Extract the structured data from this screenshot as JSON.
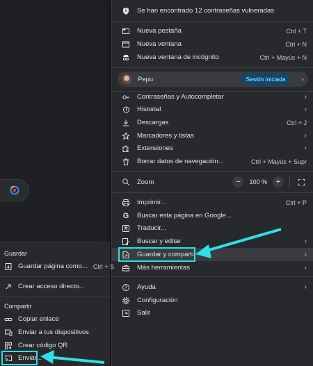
{
  "colors": {
    "bg": "#1f2023",
    "menu": "#28292c",
    "accent": "#2ee0e8",
    "badge": "#0b4a6f"
  },
  "banner": {
    "icon": "shield-icon",
    "text": "Se han encontrado 12 contraseñas vulneradas"
  },
  "group1": [
    {
      "icon": "tab-icon",
      "label": "Nueva pestaña",
      "shortcut": "Ctrl + T"
    },
    {
      "icon": "window-icon",
      "label": "Nueva ventana",
      "shortcut": "Ctrl + N"
    },
    {
      "icon": "incognito-icon",
      "label": "Nueva ventana de incógnito",
      "shortcut": "Ctrl + Mayús + N"
    }
  ],
  "profile": {
    "name": "Pepu",
    "status": "Sesión iniciada"
  },
  "group2": [
    {
      "icon": "key-icon",
      "label": "Contraseñas y Autocompletar",
      "shortcut": ""
    },
    {
      "icon": "history-icon",
      "label": "Historial",
      "shortcut": ""
    },
    {
      "icon": "download-icon",
      "label": "Descargas",
      "shortcut": "Ctrl + J"
    },
    {
      "icon": "star-icon",
      "label": "Marcadores y listas",
      "shortcut": ""
    },
    {
      "icon": "puzzle-icon",
      "label": "Extensiones",
      "shortcut": ""
    },
    {
      "icon": "trash-icon",
      "label": "Borrar datos de navegación...",
      "shortcut": "Ctrl + Mayús + Supr"
    }
  ],
  "zoom": {
    "label": "Zoom",
    "value": "100 %",
    "minus": "−",
    "plus": "+"
  },
  "group3": [
    {
      "icon": "print-icon",
      "label": "Imprimir...",
      "shortcut": "Ctrl + P"
    },
    {
      "icon": "google-icon",
      "label": "Buscar esta página en Google...",
      "shortcut": ""
    },
    {
      "icon": "translate-icon",
      "label": "Traducir...",
      "shortcut": ""
    },
    {
      "icon": "edit-icon",
      "label": "Buscar y editar",
      "shortcut": ""
    },
    {
      "icon": "save-share-icon",
      "label": "Guardar y compartir",
      "shortcut": ""
    },
    {
      "icon": "toolbox-icon",
      "label": "Más herramientas",
      "shortcut": ""
    }
  ],
  "group4": [
    {
      "icon": "help-icon",
      "label": "Ayuda"
    },
    {
      "icon": "gear-icon",
      "label": "Configuración"
    },
    {
      "icon": "exit-icon",
      "label": "Salir"
    }
  ],
  "submenu": {
    "save_title": "Guardar",
    "save_items": [
      {
        "icon": "save-page-icon",
        "label": "Guardar página como...",
        "shortcut": "Ctrl + S"
      },
      {
        "icon": "shortcut-icon",
        "label": "Crear acceso directo...",
        "shortcut": ""
      }
    ],
    "share_title": "Compartir",
    "share_items": [
      {
        "icon": "link-icon",
        "label": "Copiar enlace"
      },
      {
        "icon": "devices-icon",
        "label": "Enviar a tus dispositivos"
      },
      {
        "icon": "qr-icon",
        "label": "Crear código QR"
      },
      {
        "icon": "cast-icon",
        "label": "Enviar..."
      }
    ]
  }
}
